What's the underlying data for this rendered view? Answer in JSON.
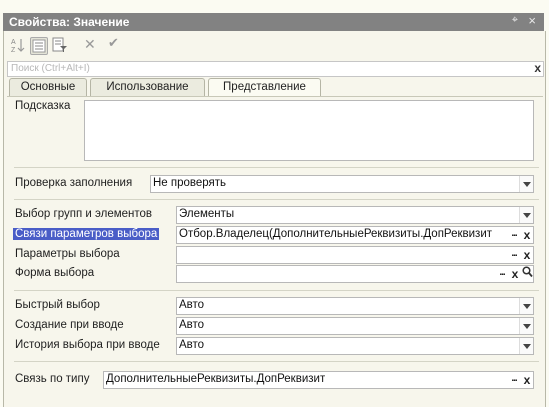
{
  "window": {
    "title": "Свойства: Значение",
    "pin_icon": "pin-icon",
    "close_icon": "close-icon"
  },
  "toolbar": {
    "icons": [
      "sort-icon",
      "categories-icon",
      "filter-icon",
      "delete-icon",
      "checkmark-icon"
    ]
  },
  "search": {
    "placeholder": "Поиск (Ctrl+Alt+I)",
    "clear": "x"
  },
  "tabs": [
    {
      "label": "Основные",
      "active": false
    },
    {
      "label": "Использование",
      "active": false
    },
    {
      "label": "Представление",
      "active": true
    }
  ],
  "form": {
    "hint_label": "Подсказка",
    "hint_value": "",
    "fill_check_label": "Проверка заполнения",
    "fill_check_value": "Не проверять",
    "groups_label": "Выбор групп и элементов",
    "groups_value": "Элементы",
    "links_label": "Связи параметров выбора",
    "links_value": "Отбор.Владелец(ДополнительныеРеквизиты.ДопРеквизит",
    "params_label": "Параметры выбора",
    "params_value": "",
    "form_label": "Форма выбора",
    "form_value": "",
    "quick_label": "Быстрый выбор",
    "quick_value": "Авто",
    "create_label": "Создание при вводе",
    "create_value": "Авто",
    "history_label": "История выбора при вводе",
    "history_value": "Авто",
    "type_link_label": "Связь по типу",
    "type_link_value": "ДополнительныеРеквизиты.ДопРеквизит"
  },
  "buttons": {
    "dots": "...",
    "clear": "x",
    "search_icon": "magnifier-icon"
  }
}
